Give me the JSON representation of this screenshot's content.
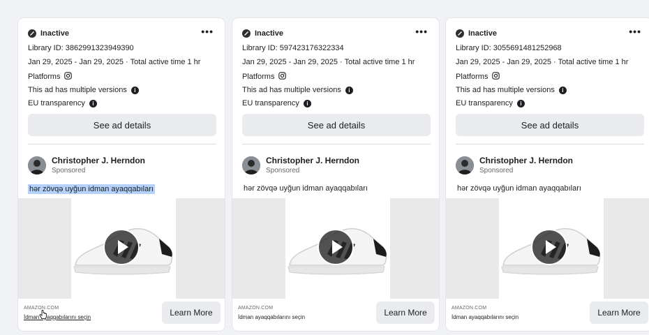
{
  "colors": {
    "page_bg": "#f0f2f5",
    "card_bg": "#ffffff",
    "button_bg": "#e9ebee",
    "selection": "#b4d2fb"
  },
  "cards": [
    {
      "status": "Inactive",
      "more": "•••",
      "library_id": "Library ID: 3862991323949390",
      "dates": "Jan 29, 2025 - Jan 29, 2025 · Total active time 1 hr",
      "platforms_label": "Platforms",
      "multiple_versions": "This ad has multiple versions",
      "eu_transparency": "EU transparency",
      "details_button": "See ad details",
      "advertiser": "Christopher J. Herndon",
      "sponsored": "Sponsored",
      "ad_text": "hər zövqə uyğun idman ayaqqabıları",
      "domain": "AMAZON.COM",
      "cta_title": "İdman ayaqqabılarını seçin",
      "cta_button": "Learn More"
    },
    {
      "status": "Inactive",
      "more": "•••",
      "library_id": "Library ID: 597423176322334",
      "dates": "Jan 29, 2025 - Jan 29, 2025 · Total active time 1 hr",
      "platforms_label": "Platforms",
      "multiple_versions": "This ad has multiple versions",
      "eu_transparency": "EU transparency",
      "details_button": "See ad details",
      "advertiser": "Christopher J. Herndon",
      "sponsored": "Sponsored",
      "ad_text": "hər zövqə uyğun idman ayaqqabıları",
      "domain": "AMAZON.COM",
      "cta_title": "İdman ayaqqabılarını seçin",
      "cta_button": "Learn More"
    },
    {
      "status": "Inactive",
      "more": "•••",
      "library_id": "Library ID: 3055691481252968",
      "dates": "Jan 29, 2025 - Jan 29, 2025 · Total active time 1 hr",
      "platforms_label": "Platforms",
      "multiple_versions": "This ad has multiple versions",
      "eu_transparency": "EU transparency",
      "details_button": "See ad details",
      "advertiser": "Christopher J. Herndon",
      "sponsored": "Sponsored",
      "ad_text": "hər zövqə uyğun idman ayaqqabıları",
      "domain": "AMAZON.COM",
      "cta_title": "İdman ayaqqabılarını seçin",
      "cta_button": "Learn More"
    }
  ],
  "icons": {
    "status": "inactive-status-icon",
    "platform": "instagram-icon",
    "info": "info-icon",
    "more": "more-options-icon",
    "play": "play-icon"
  }
}
